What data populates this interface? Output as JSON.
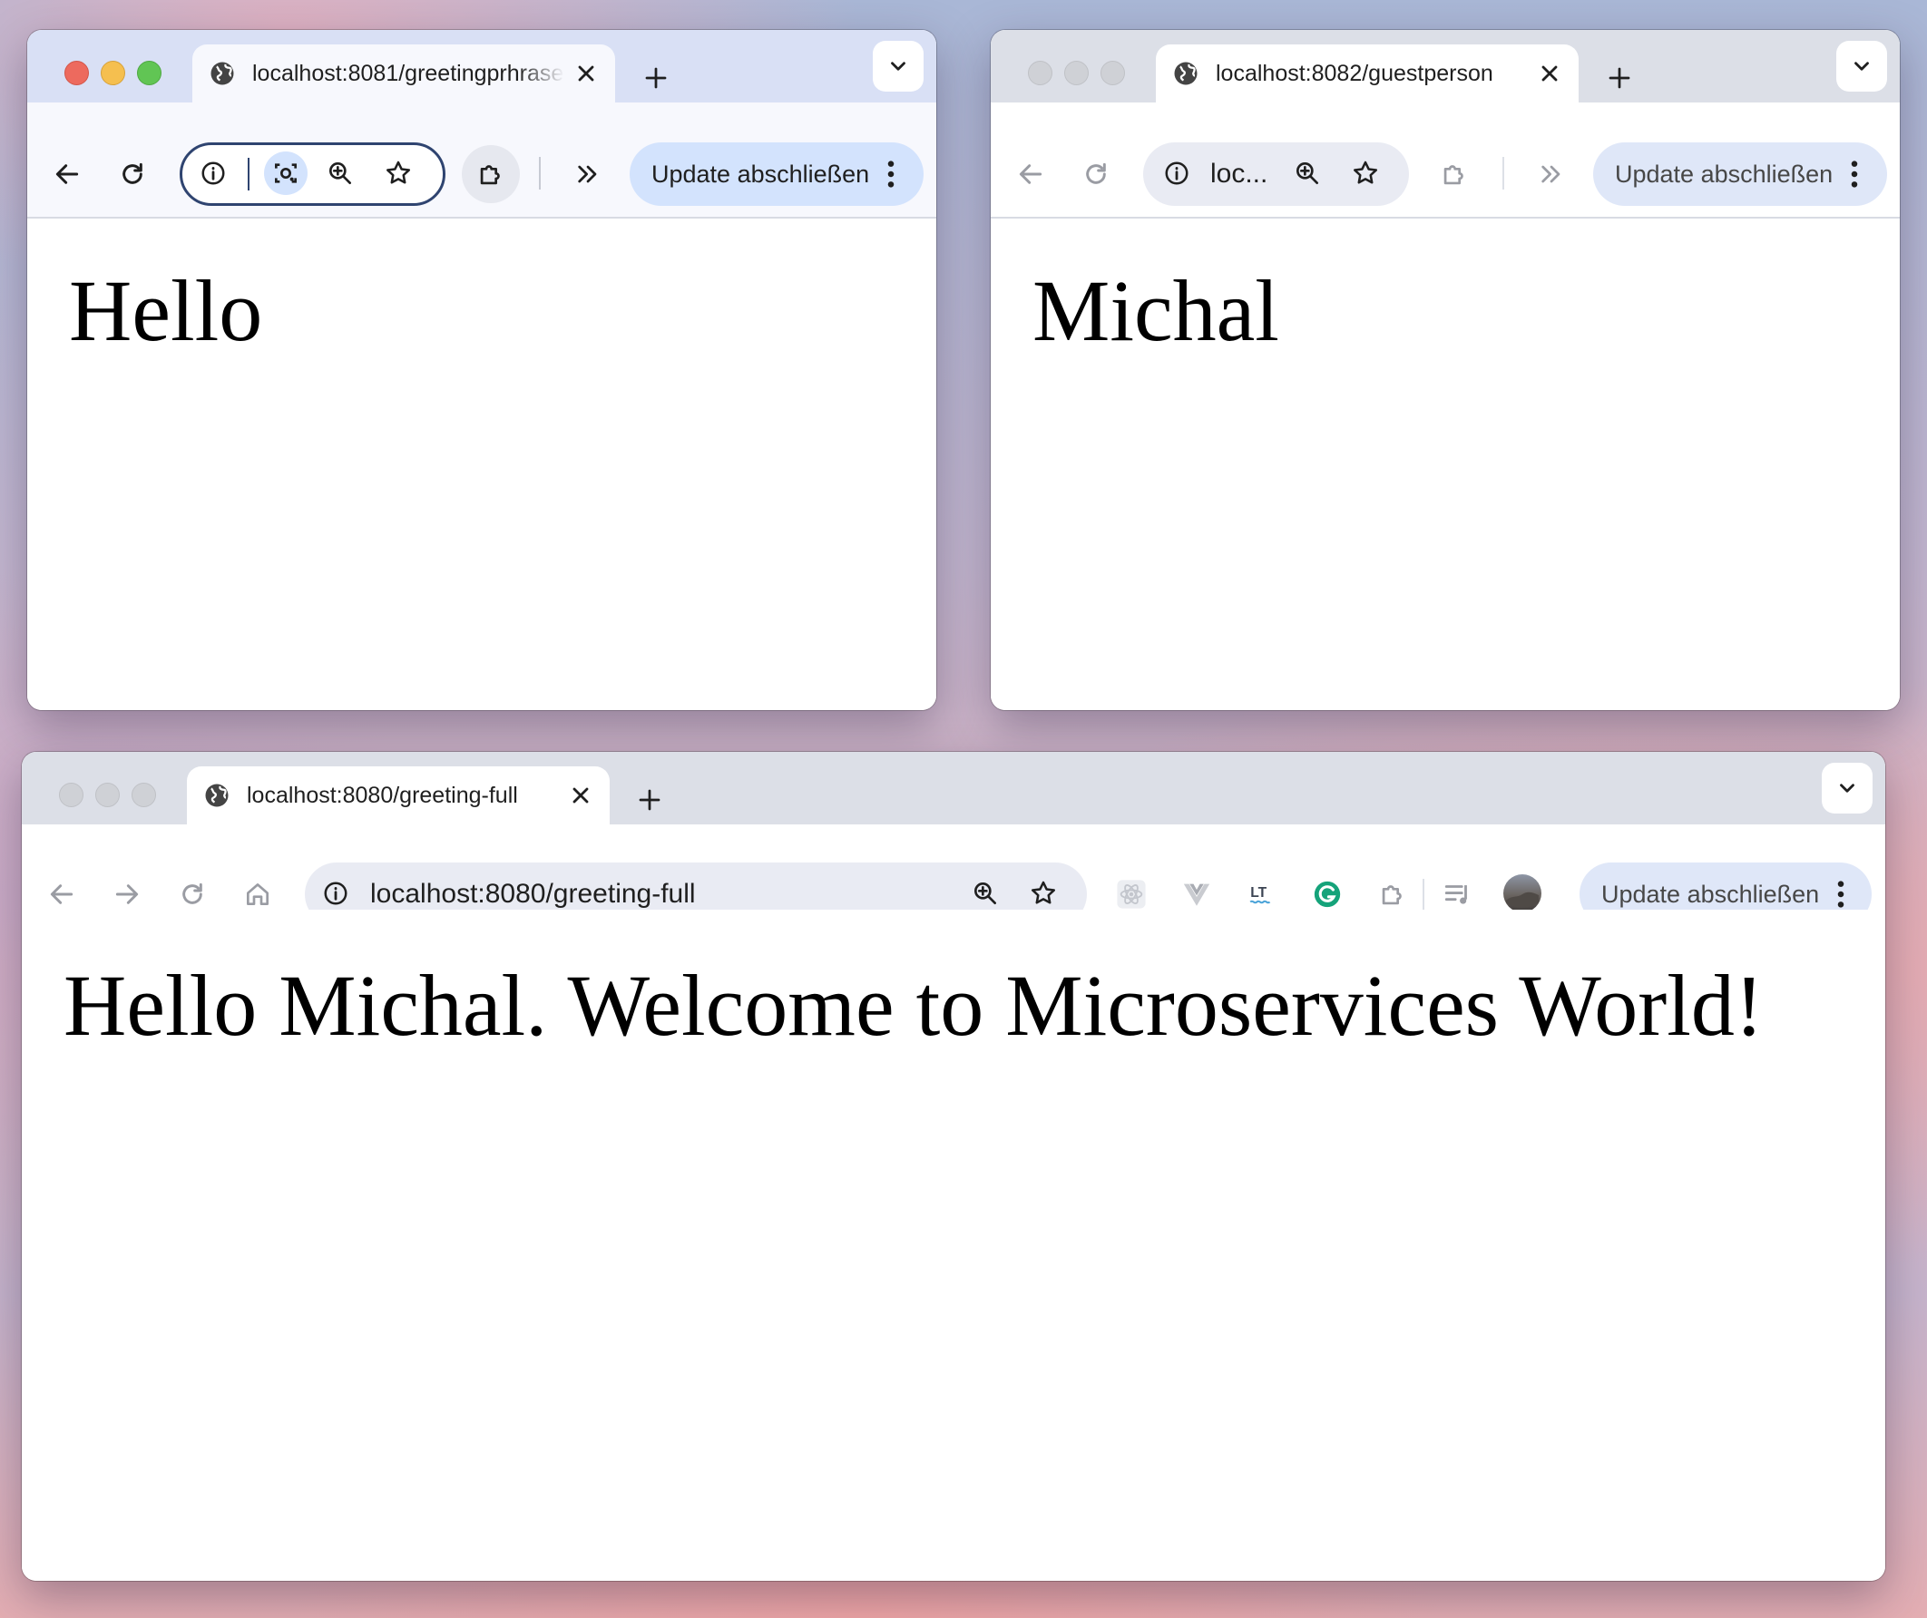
{
  "colors": {
    "active_tabbar": "#d9e0f5",
    "inactive_tabbar": "#dcdfe7",
    "update_button_bg": "#d3e3fd",
    "focus_ring": "#2f4470"
  },
  "windows": [
    {
      "tab_title": "localhost:8081/greetingprhrase",
      "url_text": "",
      "update_label": "Update abschließen",
      "page_text": "Hello"
    },
    {
      "tab_title": "localhost:8082/guestperson",
      "url_text": "loc...",
      "update_label": "Update abschließen",
      "page_text": "Michal"
    },
    {
      "tab_title": "localhost:8080/greeting-full",
      "url_text": "localhost:8080/greeting-full",
      "update_label": "Update abschließen",
      "page_text": "Hello Michal. Welcome to Microservices World!"
    }
  ]
}
